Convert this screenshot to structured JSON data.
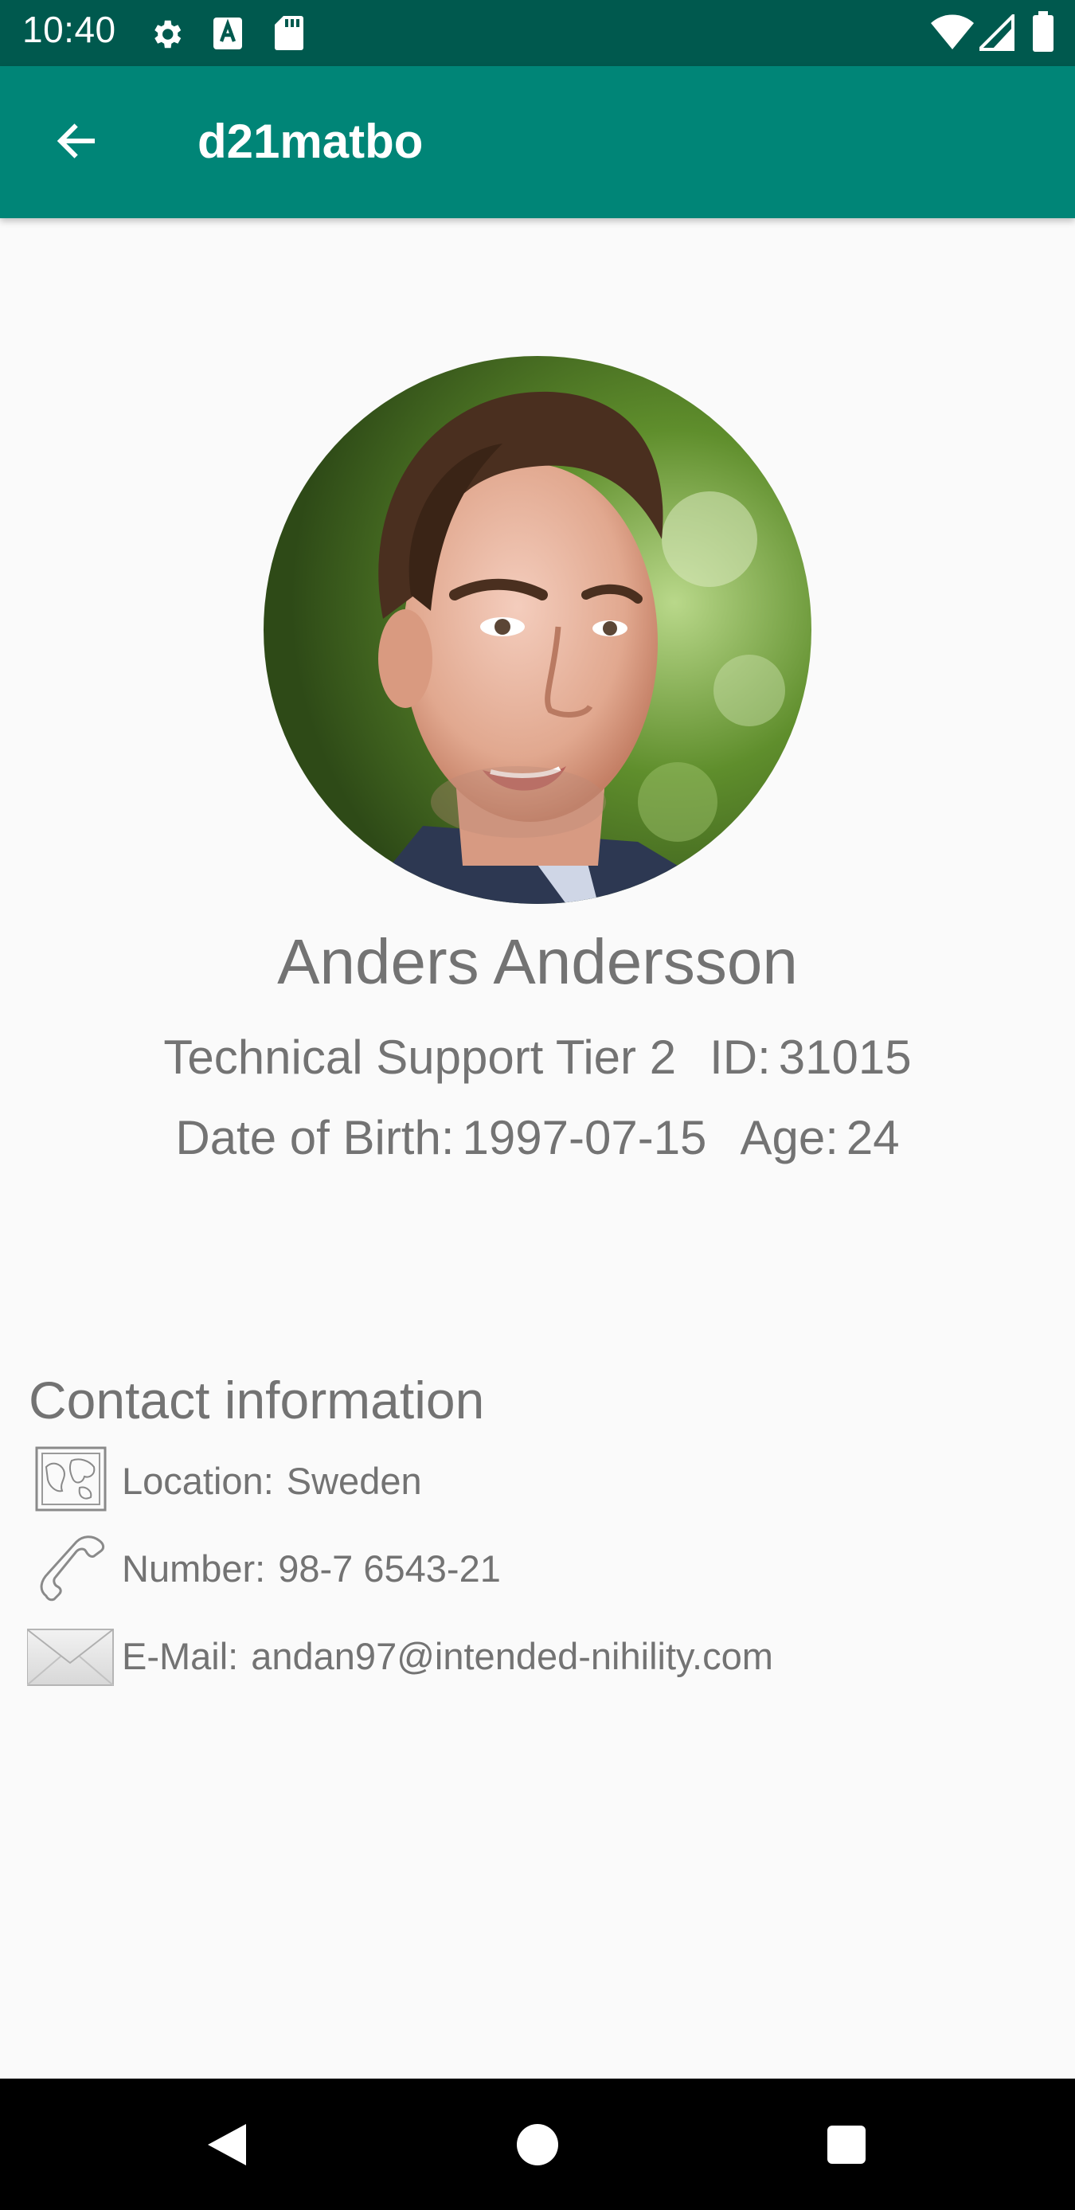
{
  "status_bar": {
    "time": "10:40",
    "left_icons": [
      "gear-icon",
      "a-letter-icon",
      "sd-card-icon"
    ],
    "right_icons": [
      "wifi-icon",
      "signal-icon",
      "battery-icon"
    ]
  },
  "app_bar": {
    "title": "d21matbo",
    "back_icon": "arrow-left-icon"
  },
  "profile": {
    "name": "Anders Andersson",
    "role": "Technical Support Tier 2",
    "id_label": "ID:",
    "id_value": "31015",
    "dob_label": "Date of Birth:",
    "dob_value": "1997-07-15",
    "age_label": "Age:",
    "age_value": "24"
  },
  "contact": {
    "heading": "Contact information",
    "items": [
      {
        "icon": "map-icon",
        "label": "Location:",
        "value": "Sweden"
      },
      {
        "icon": "phone-icon",
        "label": "Number:",
        "value": "98-7 6543-21"
      },
      {
        "icon": "envelope-icon",
        "label": "E-Mail:",
        "value": "andan97@intended-nihility.com"
      }
    ]
  },
  "nav_bar": {
    "buttons": [
      "back-triangle-icon",
      "home-circle-icon",
      "recents-square-icon"
    ]
  },
  "colors": {
    "status_bar": "#00594e",
    "app_bar": "#008577",
    "text_gray": "#737373",
    "background": "#fafafa"
  }
}
